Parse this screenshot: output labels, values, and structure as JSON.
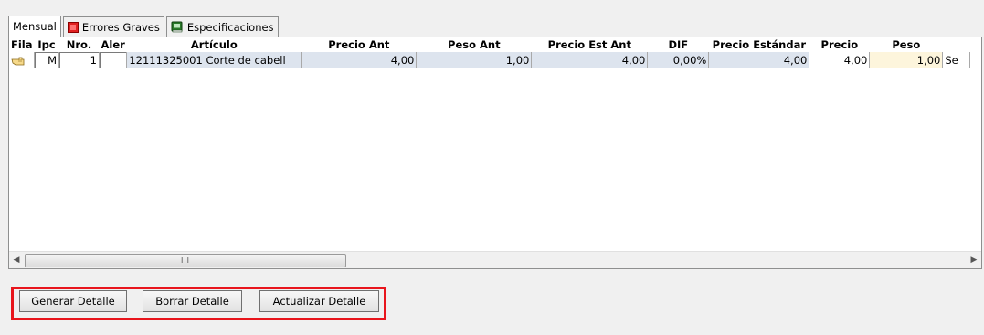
{
  "tabs": [
    {
      "label": "Mensual",
      "icon": ""
    },
    {
      "label": "Errores Graves",
      "icon": "red-square-icon"
    },
    {
      "label": "Especificaciones",
      "icon": "book-icon"
    }
  ],
  "grid": {
    "columns": [
      "Fila",
      "Ipc",
      "Nro.",
      "Aler",
      "Artículo",
      "Precio Ant",
      "Peso Ant",
      "Precio Est Ant",
      "DIF",
      "Precio Estándar",
      "Precio",
      "Peso",
      ""
    ],
    "rows": [
      {
        "fila_icon": "hand-pointer-icon",
        "ipc": "M",
        "nro": "1",
        "alerta": "",
        "articulo": "12111325001 Corte de cabell",
        "precio_ant": "4,00",
        "peso_ant": "1,00",
        "precio_est_ant": "4,00",
        "dif": "0,00%",
        "precio_estandar": "4,00",
        "precio": "4,00",
        "peso": "1,00",
        "extra": "Se"
      }
    ]
  },
  "scrollbar": {
    "thumb_grip": "III"
  },
  "buttons": {
    "generar": "Generar Detalle",
    "borrar": "Borrar Detalle",
    "actualizar": "Actualizar Detalle"
  },
  "colors": {
    "highlight_frame": "#e8151c",
    "row_selected": "#dde4ee"
  }
}
